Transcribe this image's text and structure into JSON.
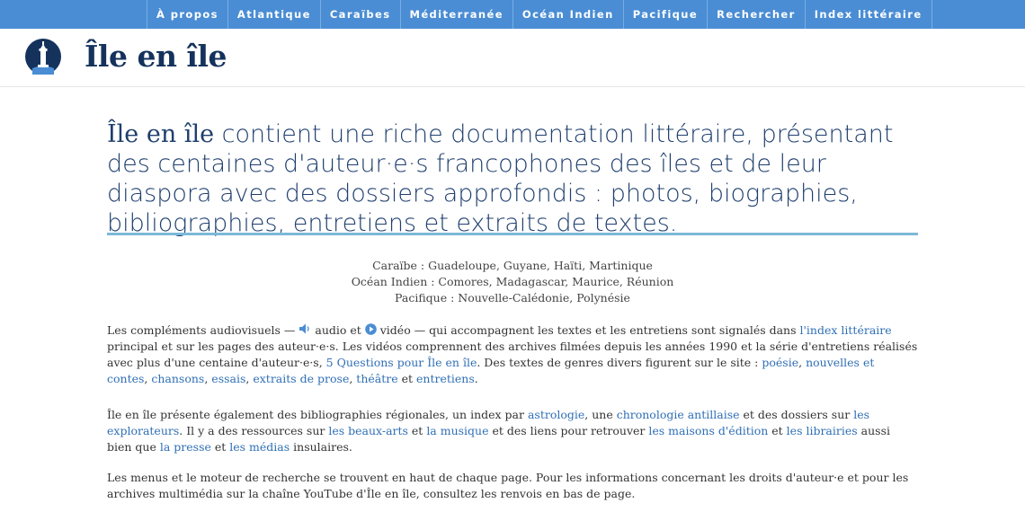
{
  "nav": {
    "items": [
      "À propos",
      "Atlantique",
      "Caraïbes",
      "Méditerranée",
      "Océan Indien",
      "Pacifique",
      "Rechercher",
      "Index littéraire"
    ]
  },
  "header": {
    "title": "Île en île"
  },
  "lead": {
    "brand": "Île en île",
    "text": " contient une riche documentation littéraire, présentant des centaines d'auteur·e·s francophones des îles et de leur diaspora avec des dossiers approfondis : photos, biographies, bibliographies, entretiens et extraits de textes."
  },
  "regions": {
    "line1": "Caraïbe : Guadeloupe, Guyane, Haïti, Martinique",
    "line2": "Océan Indien : Comores, Madagascar, Maurice, Réunion",
    "line3": "Pacifique : Nouvelle-Calédonie, Polynésie"
  },
  "p1": {
    "t1": "Les compléments audiovisuels — ",
    "t2": " audio et ",
    "t3": " vidéo — qui accompagnent les textes et les entretiens sont signalés dans ",
    "l_index": "l'index littéraire",
    "t4": " principal et sur les pages des auteur·e·s. Les vidéos comprennent des archives filmées depuis les années 1990 et la série d'entretiens réalisés avec plus d'une centaine d'auteur·e·s, ",
    "l_questions": "5 Questions pour Île en île",
    "t5": ". Des textes de genres divers figurent sur le site : ",
    "l_poesie": "poésie",
    "c1": ", ",
    "l_nouvelles": "nouvelles et contes",
    "c2": ", ",
    "l_chansons": "chansons",
    "c3": ", ",
    "l_essais": "essais",
    "c4": ", ",
    "l_prose": "extraits de prose",
    "c5": ", ",
    "l_theatre": "théâtre",
    "t6": " et ",
    "l_entretiens": "entretiens",
    "t7": "."
  },
  "p2": {
    "brand": "Île en île",
    "t1": " présente également des bibliographies régionales, un index par ",
    "l_astro": "astrologie",
    "t2": ", une ",
    "l_chrono": "chronologie antillaise",
    "t3": " et des dossiers sur ",
    "l_explo": "les explorateurs",
    "t4": ". Il y a des ressources sur ",
    "l_beaux": "les beaux-arts",
    "t5": " et ",
    "l_musique": "la musique",
    "t6": " et des liens pour retrouver ",
    "l_maisons": "les maisons d'édition",
    "t7": " et ",
    "l_libr": "les librairies",
    "t8": " aussi bien que ",
    "l_presse": "la presse",
    "t9": " et ",
    "l_medias": "les médias",
    "t10": " insulaires."
  },
  "p3": {
    "t1": "Les menus et le moteur de recherche se trouvent en haut de chaque page. Pour les informations concernant les droits d'auteur·e et pour les archives multimédia sur la chaîne YouTube d'",
    "brand": "Île en île",
    "t2": ", consultez les renvois en bas de page."
  },
  "colors": {
    "nav": "#4a8dd4",
    "title": "#14325c",
    "lead": "#1f3f6e",
    "link": "#2f6fb5",
    "rule": "#7cb8d8"
  },
  "icons": [
    "lighthouse-logo-icon",
    "audio-speaker-icon",
    "video-play-icon"
  ]
}
